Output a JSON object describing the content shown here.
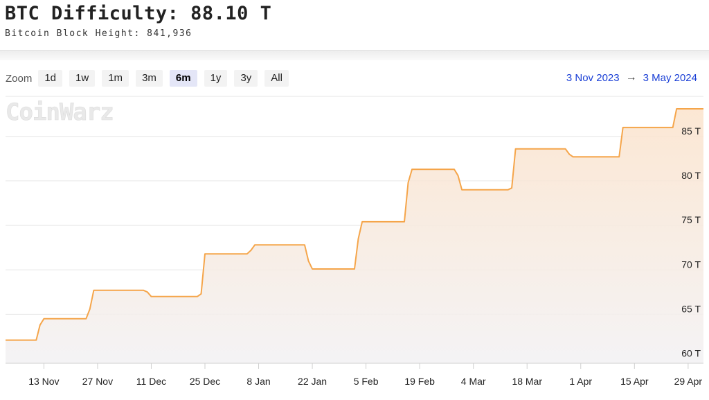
{
  "header": {
    "title": "BTC Difficulty: 88.10 T",
    "subtitle": "Bitcoin Block Height: 841,936"
  },
  "toolbar": {
    "zoom_label": "Zoom",
    "zoom_options": [
      "1d",
      "1w",
      "1m",
      "3m",
      "6m",
      "1y",
      "3y",
      "All"
    ],
    "active_zoom": "6m",
    "range_from": "3 Nov 2023",
    "range_arrow": "→",
    "range_to": "3 May 2024"
  },
  "watermark": "CoinWarz",
  "colors": {
    "line": "#f5a54a",
    "fill_top": "#fbe3cc",
    "fill_bottom": "#f3f2f4",
    "grid": "#e6e6e6",
    "link": "#1a3fd6"
  },
  "chart_data": {
    "type": "area",
    "title": "",
    "xlabel": "",
    "ylabel": "",
    "x_ticks": [
      "13 Nov",
      "27 Nov",
      "11 Dec",
      "25 Dec",
      "8 Jan",
      "22 Jan",
      "5 Feb",
      "19 Feb",
      "4 Mar",
      "18 Mar",
      "1 Apr",
      "15 Apr",
      "29 Apr"
    ],
    "y_ticks": [
      "60 T",
      "65 T",
      "70 T",
      "75 T",
      "80 T",
      "85 T"
    ],
    "xlim": [
      "2023-11-03",
      "2024-05-03"
    ],
    "ylim": [
      59.5,
      89.5
    ],
    "y_unit": "T",
    "grid": true,
    "series": [
      {
        "points": [
          [
            "2023-11-03",
            62.1
          ],
          [
            "2023-11-11",
            62.1
          ],
          [
            "2023-11-12",
            63.8
          ],
          [
            "2023-11-13",
            64.5
          ],
          [
            "2023-11-24",
            64.5
          ],
          [
            "2023-11-25",
            65.6
          ],
          [
            "2023-11-26",
            67.7
          ],
          [
            "2023-12-09",
            67.7
          ],
          [
            "2023-12-10",
            67.5
          ],
          [
            "2023-12-11",
            67.0
          ],
          [
            "2023-12-23",
            67.0
          ],
          [
            "2023-12-24",
            67.3
          ],
          [
            "2023-12-25",
            71.8
          ],
          [
            "2024-01-05",
            71.8
          ],
          [
            "2024-01-06",
            72.2
          ],
          [
            "2024-01-07",
            72.8
          ],
          [
            "2024-01-20",
            72.8
          ],
          [
            "2024-01-21",
            71.0
          ],
          [
            "2024-01-22",
            70.1
          ],
          [
            "2024-02-02",
            70.1
          ],
          [
            "2024-02-03",
            73.5
          ],
          [
            "2024-02-04",
            75.4
          ],
          [
            "2024-02-15",
            75.4
          ],
          [
            "2024-02-16",
            79.8
          ],
          [
            "2024-02-17",
            81.3
          ],
          [
            "2024-02-28",
            81.3
          ],
          [
            "2024-02-29",
            80.6
          ],
          [
            "2024-03-01",
            79.0
          ],
          [
            "2024-03-13",
            79.0
          ],
          [
            "2024-03-14",
            79.2
          ],
          [
            "2024-03-15",
            83.6
          ],
          [
            "2024-03-28",
            83.6
          ],
          [
            "2024-03-29",
            83.0
          ],
          [
            "2024-03-30",
            82.7
          ],
          [
            "2024-04-11",
            82.7
          ],
          [
            "2024-04-12",
            86.0
          ],
          [
            "2024-04-25",
            86.0
          ],
          [
            "2024-04-26",
            88.1
          ],
          [
            "2024-05-03",
            88.1
          ]
        ]
      }
    ]
  }
}
